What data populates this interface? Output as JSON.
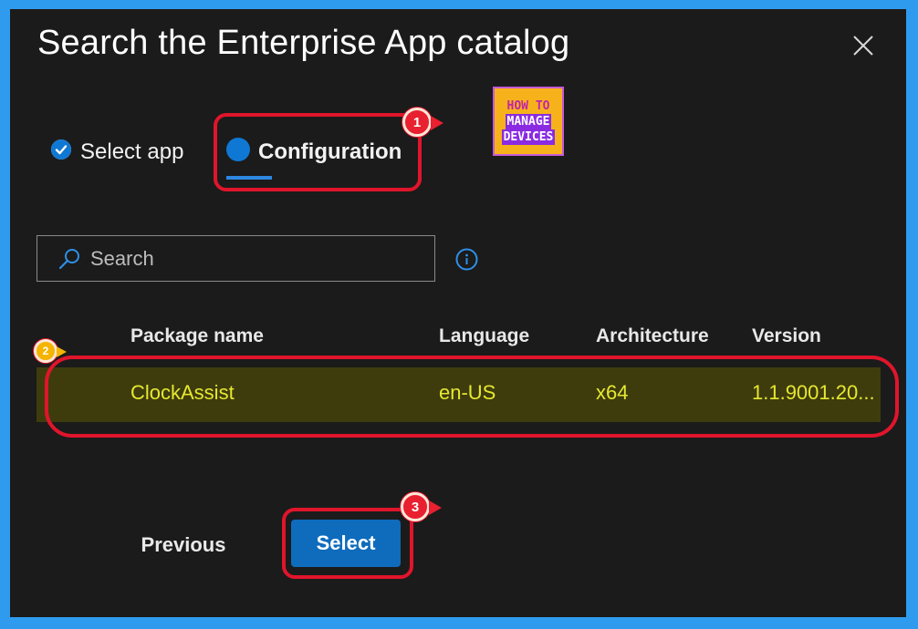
{
  "dialog": {
    "title": "Search the Enterprise App catalog",
    "close_icon": "close-icon"
  },
  "steps": [
    {
      "label": "Select app",
      "state": "completed",
      "icon": "check-circle-icon"
    },
    {
      "label": "Configuration",
      "state": "current",
      "icon": "current-step-dot-icon"
    }
  ],
  "logo": {
    "line1": "HOW TO",
    "line2": "MANAGE",
    "line3": "DEVICES"
  },
  "search": {
    "placeholder": "Search",
    "value": "",
    "icon": "search-icon",
    "info_icon": "info-icon"
  },
  "table": {
    "columns": [
      "Package name",
      "Language",
      "Architecture",
      "Version"
    ],
    "rows": [
      {
        "package_name": "ClockAssist",
        "language": "en-US",
        "architecture": "x64",
        "version": "1.1.9001.20..."
      }
    ]
  },
  "footer": {
    "previous_label": "Previous",
    "select_label": "Select"
  },
  "annotations": [
    {
      "number": "1",
      "color": "#e0152b"
    },
    {
      "number": "2",
      "color": "#f4b400"
    },
    {
      "number": "3",
      "color": "#e0152b"
    }
  ],
  "colors": {
    "accent": "#0f6cbd",
    "dialog_background": "#1b1b1b",
    "frame": "#2f9bef",
    "highlight_row": "#3e3c0d",
    "highlight_text": "#e6e830"
  }
}
